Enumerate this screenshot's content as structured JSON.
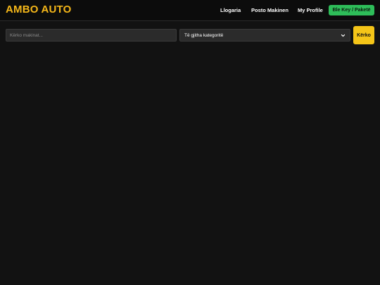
{
  "header": {
    "brand": "AMBO AUTO",
    "nav": {
      "login": "Llogaria",
      "post_car": "Posto Makinen",
      "profile": "My Profile",
      "buy_key": "Ble Key / Paketë"
    }
  },
  "search": {
    "placeholder": "Kërko makinat...",
    "value": "",
    "category_selected": "Të gjitha kategoritë",
    "button_label": "Kërko"
  },
  "colors": {
    "background": "#121212",
    "navbar": "#0c0c0c",
    "brand": "#f5b719",
    "cta_green": "#2ebd59",
    "search_button_yellow": "#f5c518",
    "field_background": "#2b2b2b"
  },
  "icons": {
    "select_arrow": "chevron-down-icon"
  }
}
